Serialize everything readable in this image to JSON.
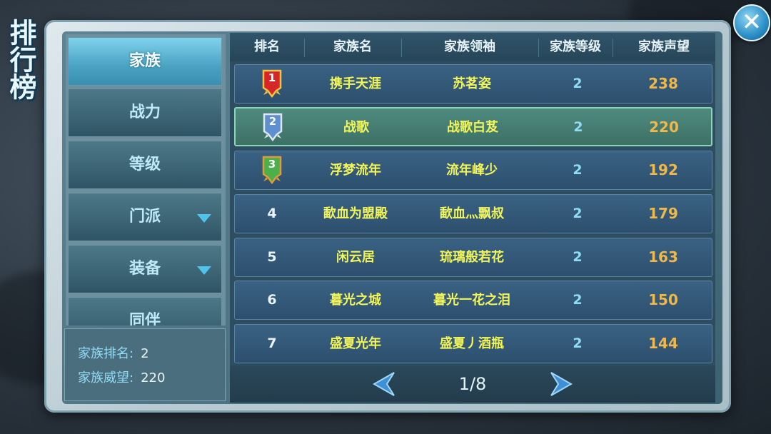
{
  "window": {
    "title": "排行榜",
    "close_icon": "close-icon"
  },
  "sidebar": {
    "items": [
      {
        "label": "家族",
        "active": true
      },
      {
        "label": "战力"
      },
      {
        "label": "等级"
      },
      {
        "label": "门派",
        "has_dropdown": true
      },
      {
        "label": "装备",
        "has_dropdown": true
      },
      {
        "label": "同伴"
      }
    ]
  },
  "info": {
    "rank_label": "家族排名:",
    "rank_value": "2",
    "reputation_label": "家族威望:",
    "reputation_value": "220"
  },
  "table": {
    "columns": [
      "排名",
      "家族名",
      "家族领袖",
      "家族等级",
      "家族声望"
    ],
    "rows": [
      {
        "rank": "1",
        "badge": "gold",
        "name": "携手天涯",
        "leader": "苏茗姿",
        "level": "2",
        "reputation": "238"
      },
      {
        "rank": "2",
        "badge": "silver",
        "name": "战歌",
        "leader": "战歌白芨",
        "level": "2",
        "reputation": "220",
        "highlight": true
      },
      {
        "rank": "3",
        "badge": "bronze",
        "name": "浮梦流年",
        "leader": "流年峰少",
        "level": "2",
        "reputation": "192"
      },
      {
        "rank": "4",
        "name": "歃血为盟殿",
        "leader": "歃血灬飘叔",
        "level": "2",
        "reputation": "179"
      },
      {
        "rank": "5",
        "name": "闲云居",
        "leader": "琉璃般若花",
        "level": "2",
        "reputation": "163"
      },
      {
        "rank": "6",
        "name": "暮光之城",
        "leader": "暮光一花之泪",
        "level": "2",
        "reputation": "150"
      },
      {
        "rank": "7",
        "name": "盛夏光年",
        "leader": "盛夏丿酒瓶",
        "level": "2",
        "reputation": "144"
      }
    ]
  },
  "pager": {
    "text": "1/8",
    "prev_icon": "arrow-left-icon",
    "next_icon": "arrow-right-icon"
  },
  "colors": {
    "accent": "#4aa3c3",
    "name_text": "#f2f55a",
    "reputation_text": "#f0b84a",
    "badge_gold": "#e23a2a",
    "badge_silver": "#5e8fd0",
    "badge_bronze": "#4bb04a"
  }
}
